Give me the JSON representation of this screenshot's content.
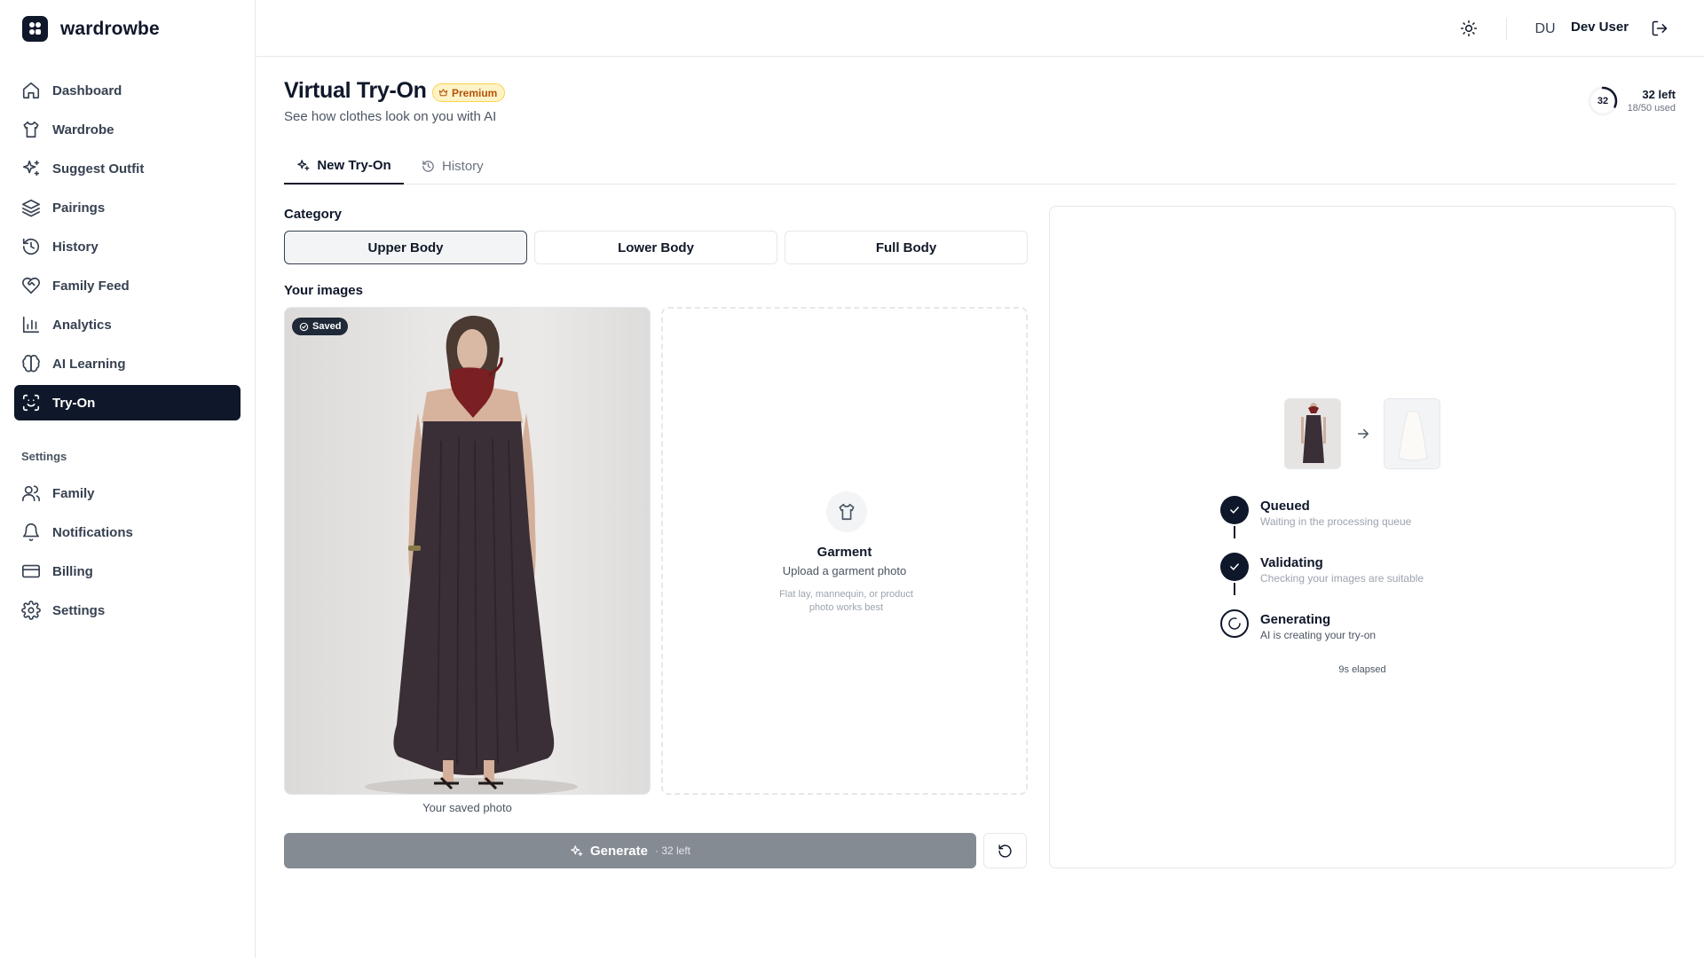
{
  "brand": {
    "name": "wardrowbe"
  },
  "sidebar": {
    "items": [
      {
        "label": "Dashboard",
        "icon": "home-icon"
      },
      {
        "label": "Wardrobe",
        "icon": "shirt-icon"
      },
      {
        "label": "Suggest Outfit",
        "icon": "sparkles-icon"
      },
      {
        "label": "Pairings",
        "icon": "layers-icon"
      },
      {
        "label": "History",
        "icon": "history-icon"
      },
      {
        "label": "Family Feed",
        "icon": "heart-handshake-icon"
      },
      {
        "label": "Analytics",
        "icon": "bar-chart-icon"
      },
      {
        "label": "AI Learning",
        "icon": "brain-icon"
      },
      {
        "label": "Try-On",
        "icon": "scan-face-icon",
        "active": true
      }
    ],
    "settings_label": "Settings",
    "settings_items": [
      {
        "label": "Family",
        "icon": "users-icon"
      },
      {
        "label": "Notifications",
        "icon": "bell-icon"
      },
      {
        "label": "Billing",
        "icon": "credit-card-icon"
      },
      {
        "label": "Settings",
        "icon": "gear-icon"
      }
    ]
  },
  "topbar": {
    "theme_icon": "sun-icon",
    "avatar_initials": "DU",
    "user_name": "Dev User",
    "logout_icon": "logout-icon"
  },
  "header": {
    "title": "Virtual Try-On",
    "badge": "Premium",
    "subtitle": "See how clothes look on you with AI",
    "quota": {
      "remaining": "32",
      "remaining_label": "32 left",
      "used_label": "18/50 used",
      "used_fraction": 0.36
    }
  },
  "tabs": [
    {
      "label": "New Try-On",
      "active": true
    },
    {
      "label": "History",
      "active": false
    }
  ],
  "category": {
    "label": "Category",
    "options": [
      {
        "label": "Upper Body",
        "selected": true
      },
      {
        "label": "Lower Body",
        "selected": false
      },
      {
        "label": "Full Body",
        "selected": false
      }
    ]
  },
  "images": {
    "label": "Your images",
    "person": {
      "badge": "Saved",
      "caption": "Your saved photo"
    },
    "garment": {
      "title": "Garment",
      "subtitle": "Upload a garment photo",
      "hint": "Flat lay, mannequin, or product photo works best"
    }
  },
  "actions": {
    "generate_label": "Generate",
    "generate_count": "· 32 left"
  },
  "progress": {
    "steps": [
      {
        "title": "Queued",
        "desc": "Waiting in the processing queue",
        "state": "done"
      },
      {
        "title": "Validating",
        "desc": "Checking your images are suitable",
        "state": "done"
      },
      {
        "title": "Generating",
        "desc": "AI is creating your try-on",
        "state": "active"
      }
    ],
    "elapsed": "9s elapsed"
  },
  "colors": {
    "primary": "#0f172a",
    "premium_bg": "#fef3c7",
    "premium_text": "#b45309",
    "dress": "#3a2f36",
    "scarf": "#7a1f22"
  }
}
